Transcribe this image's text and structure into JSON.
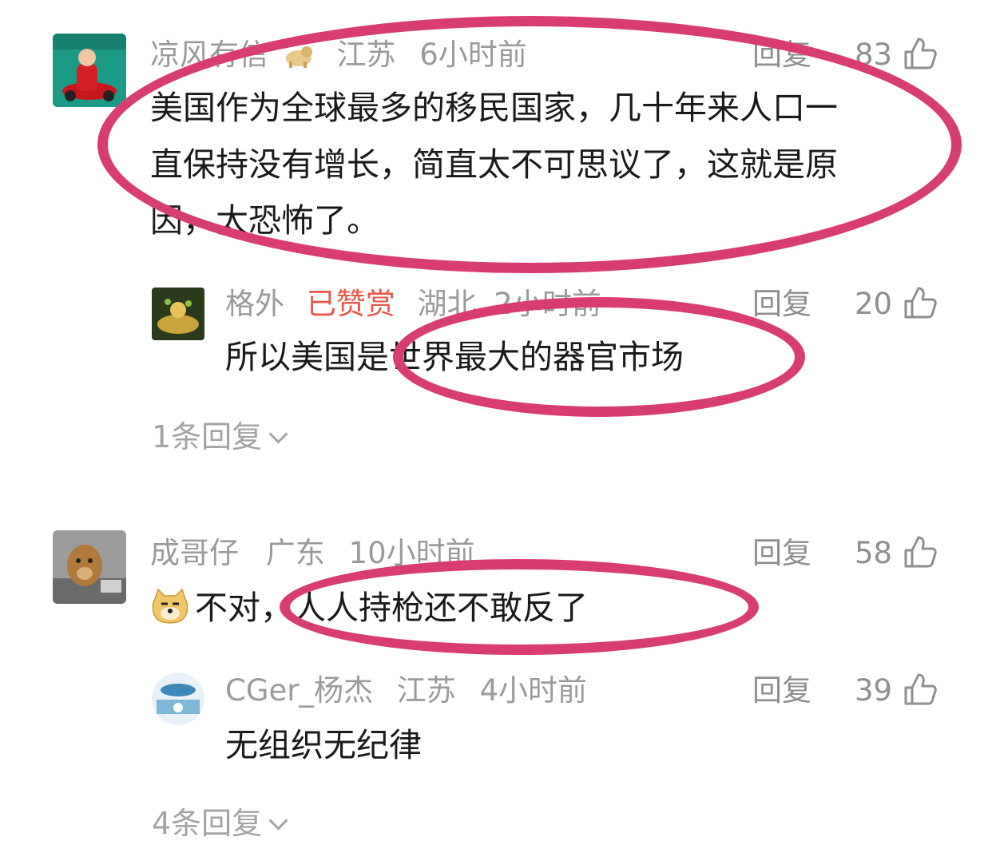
{
  "comments": [
    {
      "author": "凉风有信",
      "region": "江苏",
      "time": "6小时前",
      "reply_label": "回复",
      "likes": "83",
      "lines": [
        "美国作为全球最多的移民国家，几十年来人口一",
        "直保持没有增长，简直太不可思议了，这就是原",
        "因，太恐怖了。"
      ],
      "replies": [
        {
          "author": "格外",
          "badge": "已赞赏",
          "region": "湖北",
          "time": "2小时前",
          "reply_label": "回复",
          "likes": "20",
          "text": "所以美国是世界最大的器官市场"
        }
      ],
      "more_replies": "1条回复"
    },
    {
      "author": "成哥仔",
      "region": "广东",
      "time": "10小时前",
      "reply_label": "回复",
      "likes": "58",
      "emoji": "doge-emoji",
      "text": "不对，人人持枪还不敢反了",
      "replies": [
        {
          "author": "CGer_杨杰",
          "region": "江苏",
          "time": "4小时前",
          "reply_label": "回复",
          "likes": "39",
          "text": "无组织无纪律"
        }
      ],
      "more_replies": "4条回复"
    }
  ],
  "colors": {
    "meta_gray": "#9a9a9a",
    "badge_red": "#e8564a",
    "annotation_pink": "#d83d72"
  },
  "icons": {
    "like": "thumbs-up-icon",
    "expand": "chevron-down-icon"
  }
}
